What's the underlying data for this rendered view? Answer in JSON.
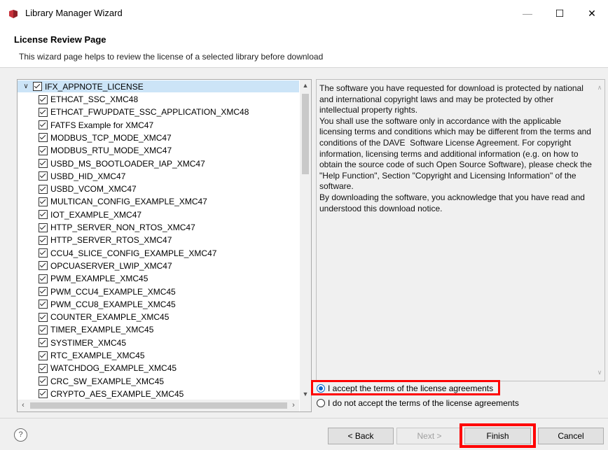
{
  "window": {
    "title": "Library Manager Wizard",
    "minimize_glyph": "—",
    "maximize_glyph": "☐",
    "close_glyph": "✕"
  },
  "header": {
    "title": "License Review Page",
    "description": "This wizard page helps to review the license of a selected library before download"
  },
  "tree": {
    "root_label": "IFX_APPNOTE_LICENSE",
    "root_checked": true,
    "items": [
      "ETHCAT_SSC_XMC48",
      "ETHCAT_FWUPDATE_SSC_APPLICATION_XMC48",
      "FATFS Example for XMC47",
      "MODBUS_TCP_MODE_XMC47",
      "MODBUS_RTU_MODE_XMC47",
      "USBD_MS_BOOTLOADER_IAP_XMC47",
      "USBD_HID_XMC47",
      "USBD_VCOM_XMC47",
      "MULTICAN_CONFIG_EXAMPLE_XMC47",
      "IOT_EXAMPLE_XMC47",
      "HTTP_SERVER_NON_RTOS_XMC47",
      "HTTP_SERVER_RTOS_XMC47",
      "CCU4_SLICE_CONFIG_EXAMPLE_XMC47",
      "OPCUASERVER_LWIP_XMC47",
      "PWM_EXAMPLE_XMC45",
      "PWM_CCU4_EXAMPLE_XMC45",
      "PWM_CCU8_EXAMPLE_XMC45",
      "COUNTER_EXAMPLE_XMC45",
      "TIMER_EXAMPLE_XMC45",
      "SYSTIMER_XMC45",
      "RTC_EXAMPLE_XMC45",
      "WATCHDOG_EXAMPLE_XMC45",
      "CRC_SW_EXAMPLE_XMC45",
      "CRYPTO_AES_EXAMPLE_XMC45"
    ]
  },
  "license": {
    "text": "The software you have requested for download is protected by national and international copyright laws and may be protected by other intellectual property rights.\nYou shall use the software only in accordance with the applicable licensing terms and conditions which may be different from the terms and conditions of the DAVE  Software License Agreement. For copyright information, licensing terms and additional information (e.g. on how to obtain the source code of such Open Source Software), please check the \"Help Function\", Section \"Copyright and Licensing Information\" of the software.\nBy downloading the software, you acknowledge that you have read and understood this download notice."
  },
  "options": {
    "accept_label": "I accept the terms of the license agreements",
    "decline_label": "I do not accept the terms of the license agreements",
    "selected": "accept"
  },
  "buttons": {
    "help": "?",
    "back": "< Back",
    "next": "Next >",
    "finish": "Finish",
    "cancel": "Cancel"
  },
  "highlight_color": "#ff0000"
}
